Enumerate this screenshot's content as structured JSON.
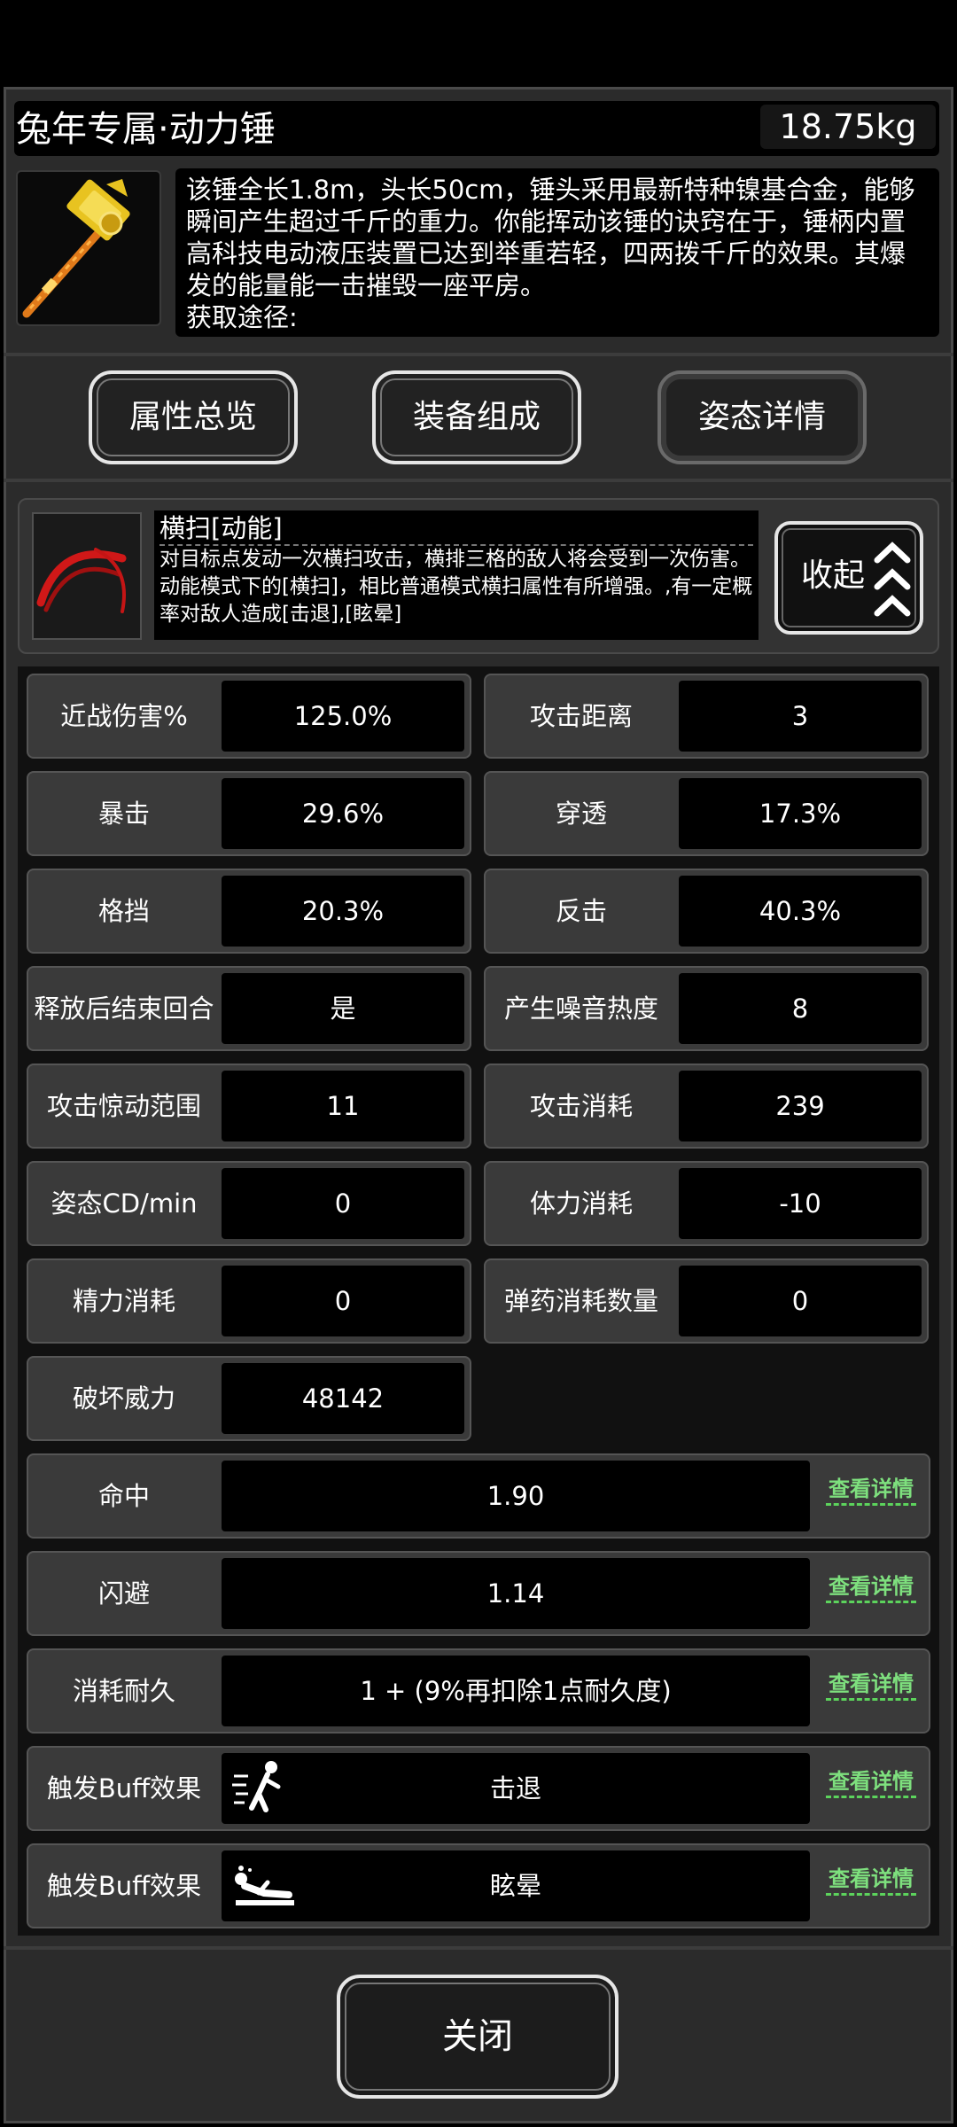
{
  "item": {
    "title": "兔年专属·动力锤",
    "weight": "18.75kg",
    "description": "该锤全长1.8m，头长50cm，锤头采用最新特种镍基合金，能够瞬间产生超过千斤的重力。你能挥动该锤的诀窍在于，锤柄内置高科技电动液压装置已达到举重若轻，四两拨千斤的效果。其爆发的能量能一击摧毁一座平房。",
    "source_label": "获取途径:"
  },
  "tabs": [
    "属性总览",
    "装备组成",
    "姿态详情"
  ],
  "skill": {
    "name": "横扫[动能]",
    "description": "对目标点发动一次横扫攻击，横排三格的敌人将会受到一次伤害。动能模式下的[横扫]，相比普通模式横扫属性有所增强。,有一定概率对敌人造成[击退],[眩晕]",
    "collapse_label": "收起"
  },
  "stats": [
    {
      "label": "近战伤害%",
      "value": "125.0%"
    },
    {
      "label": "攻击距离",
      "value": "3"
    },
    {
      "label": "暴击",
      "value": "29.6%"
    },
    {
      "label": "穿透",
      "value": "17.3%"
    },
    {
      "label": "格挡",
      "value": "20.3%"
    },
    {
      "label": "反击",
      "value": "40.3%"
    },
    {
      "label": "释放后结束回合",
      "value": "是"
    },
    {
      "label": "产生噪音热度",
      "value": "8"
    },
    {
      "label": "攻击惊动范围",
      "value": "11"
    },
    {
      "label": "攻击消耗",
      "value": "239"
    },
    {
      "label": "姿态CD/min",
      "value": "0"
    },
    {
      "label": "体力消耗",
      "value": "-10"
    },
    {
      "label": "精力消耗",
      "value": "0"
    },
    {
      "label": "弹药消耗数量",
      "value": "0"
    },
    {
      "label": "破坏威力",
      "value": "48142"
    }
  ],
  "detail_rows": [
    {
      "label": "命中",
      "value": "1.90",
      "link": "查看详情"
    },
    {
      "label": "闪避",
      "value": "1.14",
      "link": "查看详情"
    },
    {
      "label": "消耗耐久",
      "value": "1 + (9%再扣除1点耐久度)",
      "link": "查看详情"
    },
    {
      "label": "触发Buff效果",
      "value": "击退",
      "link": "查看详情",
      "icon": "knockback-icon"
    },
    {
      "label": "触发Buff效果",
      "value": "眩晕",
      "link": "查看详情",
      "icon": "stun-icon"
    }
  ],
  "close_label": "关闭",
  "colors": {
    "link": "#7ee07e",
    "panel": "#2b2b2b",
    "cell": "#3a3a3a"
  }
}
